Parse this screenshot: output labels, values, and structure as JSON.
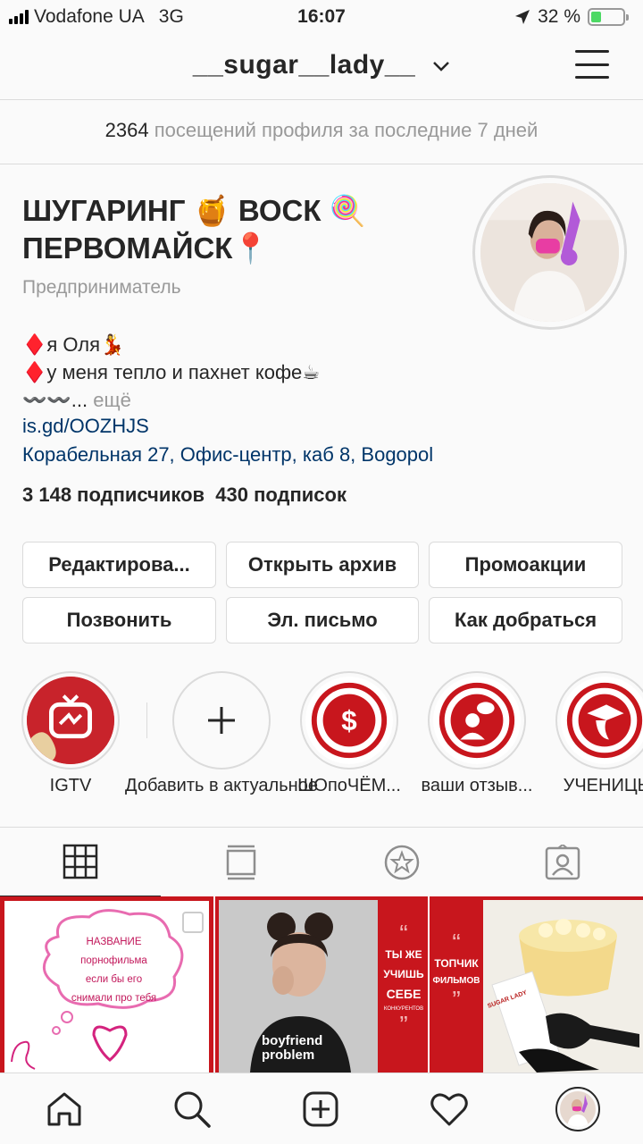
{
  "status_bar": {
    "carrier": "Vodafone UA",
    "network": "3G",
    "time": "16:07",
    "battery": "32 %",
    "battery_level": 0.32
  },
  "header": {
    "username": "__sugar__lady__"
  },
  "insights": {
    "visits_count": "2364",
    "visits_text": "посещений профиля за последние 7 дней"
  },
  "profile": {
    "name_line1": "ШУГАРИНГ 🍯 ВОСК 🍭",
    "name_line2": "ПЕРВОМАЙСК📍",
    "category": "Предприниматель",
    "bio_line1": "♦️я Оля💃",
    "bio_line2": "♦️у меня тепло и пахнет кофе☕",
    "bio_line3": "〰️〰️...",
    "bio_more": "ещё",
    "link": "is.gd/OOZHJS",
    "address": "Корабельная 27, Офис-центр, каб 8, Bogopol",
    "followers": "3 148 подписчиков",
    "following": "430 подписок"
  },
  "buttons": {
    "edit": "Редактирова...",
    "archive": "Открыть архив",
    "promotions": "Промоакции",
    "call": "Позвонить",
    "email": "Эл. письмо",
    "directions": "Как добраться"
  },
  "highlights": [
    {
      "label": "IGTV"
    },
    {
      "label": "Добавить в актуальное"
    },
    {
      "label": "ШОпоЧЁМ..."
    },
    {
      "label": "ваши отзыв..."
    },
    {
      "label": "УЧЕНИЦЫ"
    }
  ],
  "posts": {
    "post1_lines": [
      "НАЗВАНИЕ",
      "порнофильма",
      "если бы его",
      "снимали про тебя"
    ],
    "post2_shirt": "boyfriend problem",
    "post2_quote_open": "“",
    "post2_lines": [
      "ТЫ ЖЕ",
      "УЧИШЬ",
      "СЕБЕ"
    ],
    "post2_small": "КОНКУРЕНТОВ",
    "post2_quote_close": "”",
    "post3_quote_open": "“",
    "post3_lines": [
      "ТОПЧИК",
      "ФИЛЬМОВ"
    ],
    "post3_quote_close": "”",
    "post3_box": "SUGAR LADY"
  },
  "colors": {
    "accent_red": "#c8161d",
    "link_blue": "#003569",
    "muted": "#999999",
    "battery_green": "#4cd964"
  }
}
